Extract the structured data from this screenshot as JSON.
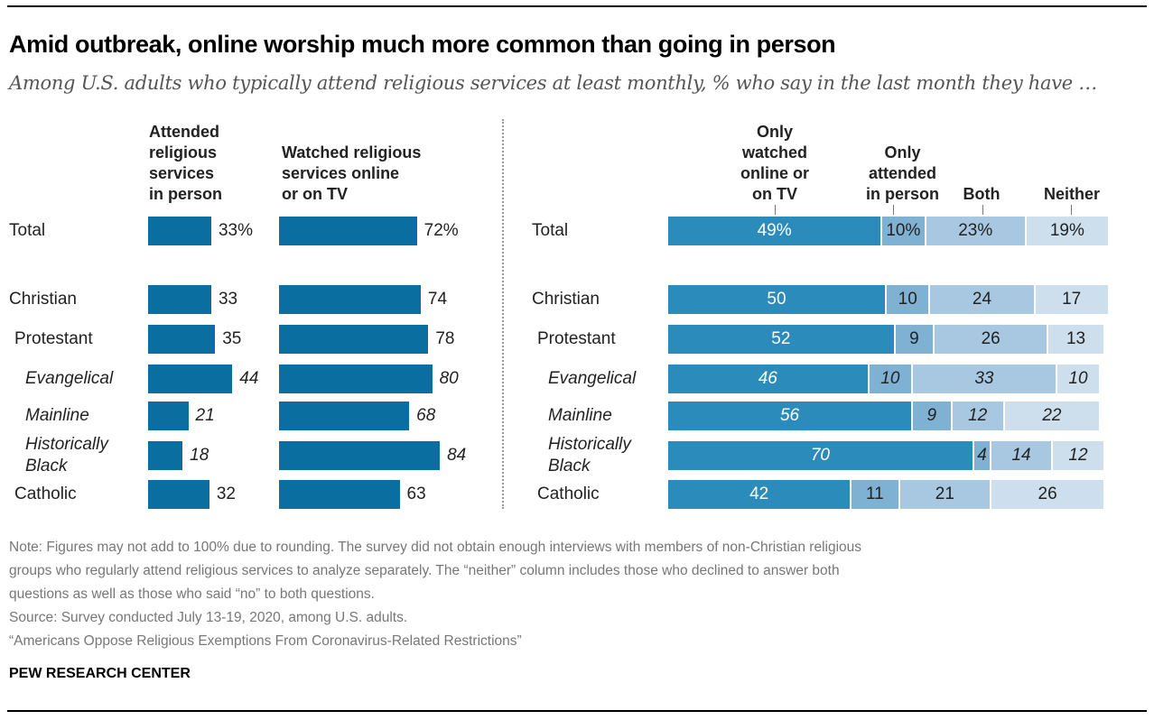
{
  "header": {
    "title": "Amid outbreak, online worship much more common than going in person",
    "subtitle": "Among U.S. adults who typically attend religious services at least monthly, % who say in the last month they have …"
  },
  "colors": {
    "left_bar": "#0b6ea1",
    "seg_only_watched": "#2b8cbb",
    "seg_only_attended": "#7fb1d3",
    "seg_both": "#a7c8e0",
    "seg_neither": "#cddfed",
    "text_dark": "#222222",
    "text_light": "#ffffff"
  },
  "chart_data": [
    {
      "type": "bar",
      "orientation": "horizontal",
      "title": "",
      "categories": [
        "Total",
        "Christian",
        "Protestant",
        "Evangelical",
        "Mainline",
        "Historically Black",
        "Catholic"
      ],
      "category_italic": [
        false,
        false,
        false,
        true,
        true,
        true,
        false
      ],
      "series": [
        {
          "name": "Attended religious services in person",
          "values": [
            33,
            33,
            35,
            44,
            21,
            18,
            32
          ],
          "labels": [
            "33%",
            "33",
            "35",
            "44",
            "21",
            "18",
            "32"
          ]
        },
        {
          "name": "Watched religious services online or on TV",
          "values": [
            72,
            74,
            78,
            80,
            68,
            84,
            63
          ],
          "labels": [
            "72%",
            "74",
            "78",
            "80",
            "68",
            "84",
            "63"
          ]
        }
      ],
      "xlim": [
        0,
        100
      ]
    },
    {
      "type": "bar",
      "orientation": "horizontal",
      "stacked": true,
      "categories": [
        "Total",
        "Christian",
        "Protestant",
        "Evangelical",
        "Mainline",
        "Historically Black",
        "Catholic"
      ],
      "category_italic": [
        false,
        false,
        false,
        true,
        true,
        true,
        false
      ],
      "series": [
        {
          "name": "Only watched online or on TV",
          "values": [
            49,
            50,
            52,
            46,
            56,
            70,
            42
          ],
          "labels": [
            "49%",
            "50",
            "52",
            "46",
            "56",
            "70",
            "42"
          ]
        },
        {
          "name": "Only attended in person",
          "values": [
            10,
            10,
            9,
            10,
            9,
            4,
            11
          ],
          "labels": [
            "10%",
            "10",
            "9",
            "10",
            "9",
            "4",
            "11"
          ]
        },
        {
          "name": "Both",
          "values": [
            23,
            24,
            26,
            33,
            12,
            14,
            21
          ],
          "labels": [
            "23%",
            "24",
            "26",
            "33",
            "12",
            "14",
            "21"
          ]
        },
        {
          "name": "Neither",
          "values": [
            19,
            17,
            13,
            10,
            22,
            12,
            26
          ],
          "labels": [
            "19%",
            "17",
            "13",
            "10",
            "22",
            "12",
            "26"
          ]
        }
      ],
      "xlim": [
        0,
        100
      ]
    }
  ],
  "left_headers": {
    "attended": [
      "Attended",
      "religious",
      "services",
      "in person"
    ],
    "watched": [
      "Watched religious",
      "services online",
      "or on TV"
    ]
  },
  "right_headers": {
    "only_watched": [
      "Only",
      "watched",
      "online or",
      "on TV"
    ],
    "only_attended": [
      "Only",
      "attended",
      "in person"
    ],
    "both": [
      "Both"
    ],
    "neither": [
      "Neither"
    ]
  },
  "row_labels": [
    {
      "lines": [
        "Total"
      ]
    },
    {
      "lines": [
        "Christian"
      ]
    },
    {
      "lines": [
        "Protestant"
      ]
    },
    {
      "lines": [
        "Evangelical"
      ]
    },
    {
      "lines": [
        "Mainline"
      ]
    },
    {
      "lines": [
        "Historically",
        "Black"
      ]
    },
    {
      "lines": [
        "Catholic"
      ]
    }
  ],
  "notes": {
    "line1": "Note: Figures may not add to 100% due to rounding. The survey did not obtain enough interviews with members of non-Christian religious",
    "line2": "groups who regularly attend religious services to analyze separately. The “neither” column includes those who declined to answer both",
    "line3": "questions as well as those who said “no” to both questions.",
    "source": "Source: Survey conducted July 13-19, 2020, among U.S. adults.",
    "report": "“Americans Oppose Religious Exemptions From Coronavirus-Related Restrictions”"
  },
  "brand": "PEW RESEARCH CENTER"
}
